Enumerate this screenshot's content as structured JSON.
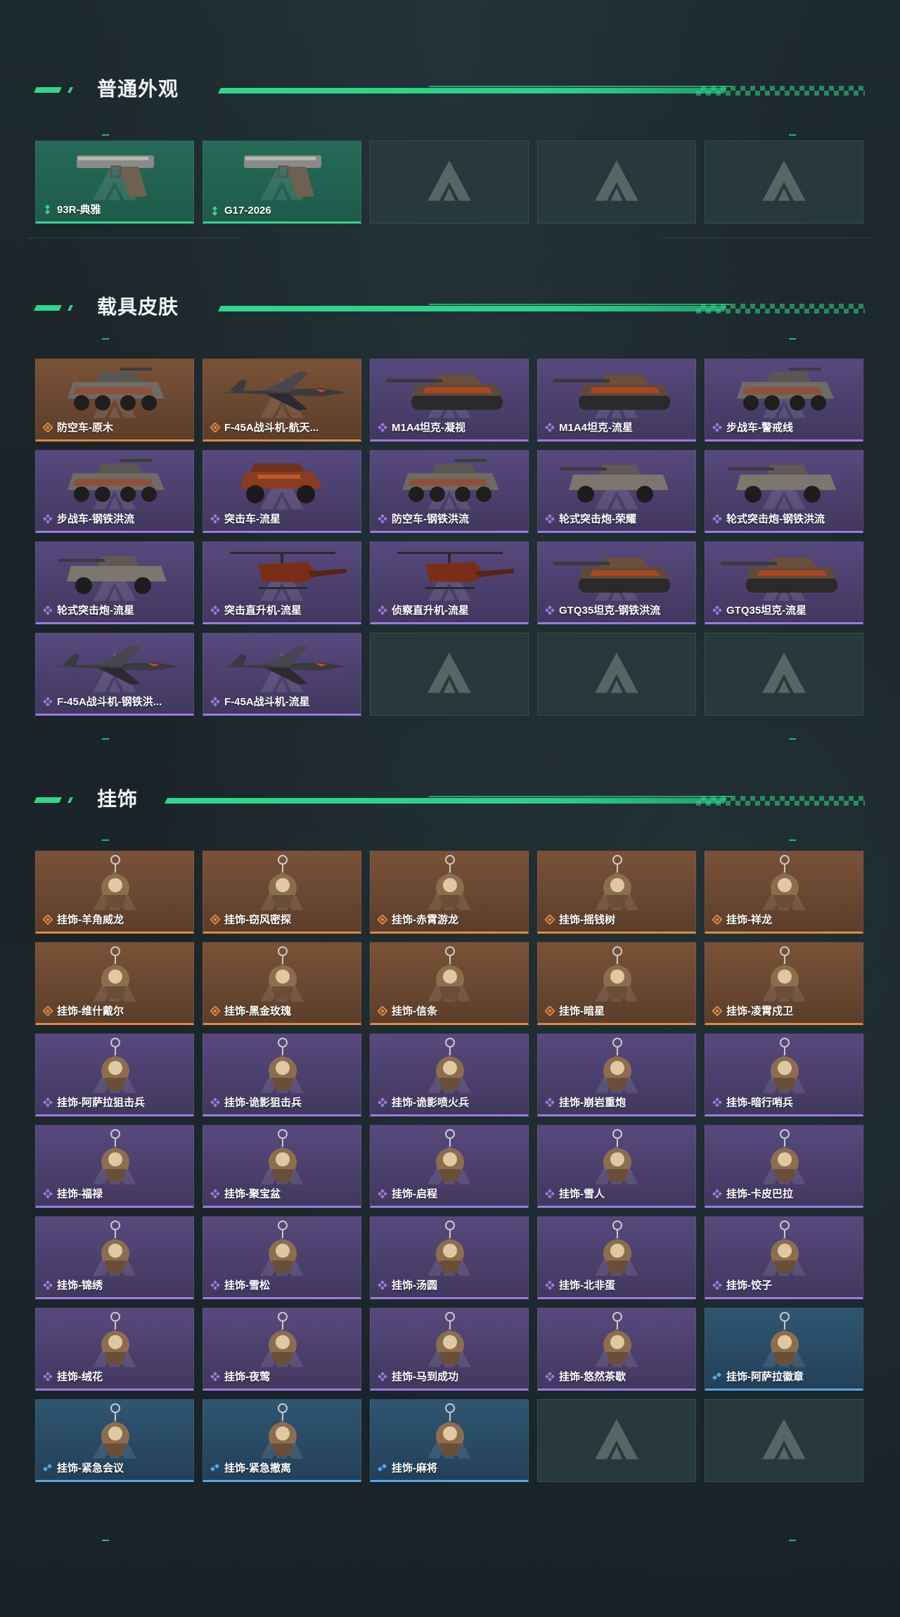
{
  "colors": {
    "accent": "#2fd88b",
    "rarity_green": "#31d690",
    "rarity_orange": "#e2883f",
    "rarity_purple": "#9c7be0",
    "rarity_blue": "#56a8e6"
  },
  "sections": {
    "normal_appearance": {
      "title": "普通外观",
      "items": [
        {
          "label": "93R-典雅",
          "rarity": "green",
          "icon": "pistol-icon"
        },
        {
          "label": "G17-2026",
          "rarity": "green",
          "icon": "pistol-icon"
        },
        {
          "label": "",
          "rarity": "empty"
        },
        {
          "label": "",
          "rarity": "empty"
        },
        {
          "label": "",
          "rarity": "empty"
        }
      ]
    },
    "vehicle_skins": {
      "title": "载具皮肤",
      "items": [
        {
          "label": "防空车-原木",
          "rarity": "orange",
          "icon": "armored-vehicle-icon"
        },
        {
          "label": "F-45A战斗机-航天...",
          "rarity": "orange",
          "icon": "fighter-jet-icon"
        },
        {
          "label": "M1A4坦克-凝视",
          "rarity": "purple",
          "icon": "tank-icon"
        },
        {
          "label": "M1A4坦克-流星",
          "rarity": "purple",
          "icon": "tank-icon"
        },
        {
          "label": "步战车-警戒线",
          "rarity": "purple",
          "icon": "armored-vehicle-icon"
        },
        {
          "label": "步战车-钢铁洪流",
          "rarity": "purple",
          "icon": "armored-vehicle-icon"
        },
        {
          "label": "突击车-流星",
          "rarity": "purple",
          "icon": "assault-vehicle-icon"
        },
        {
          "label": "防空车-钢铁洪流",
          "rarity": "purple",
          "icon": "armored-vehicle-icon"
        },
        {
          "label": "轮式突击炮-荣耀",
          "rarity": "purple",
          "icon": "wheeled-gun-icon"
        },
        {
          "label": "轮式突击炮-钢铁洪流",
          "rarity": "purple",
          "icon": "wheeled-gun-icon"
        },
        {
          "label": "轮式突击炮-流星",
          "rarity": "purple",
          "icon": "wheeled-gun-icon"
        },
        {
          "label": "突击直升机-流星",
          "rarity": "purple",
          "icon": "helicopter-icon"
        },
        {
          "label": "侦察直升机-流星",
          "rarity": "purple",
          "icon": "helicopter-icon"
        },
        {
          "label": "GTQ35坦克-钢铁洪流",
          "rarity": "purple",
          "icon": "tank-icon"
        },
        {
          "label": "GTQ35坦克-流星",
          "rarity": "purple",
          "icon": "tank-icon"
        },
        {
          "label": "F-45A战斗机-钢铁洪...",
          "rarity": "purple",
          "icon": "fighter-jet-icon"
        },
        {
          "label": "F-45A战斗机-流星",
          "rarity": "purple",
          "icon": "fighter-jet-icon"
        },
        {
          "label": "",
          "rarity": "empty"
        },
        {
          "label": "",
          "rarity": "empty"
        },
        {
          "label": "",
          "rarity": "empty"
        }
      ]
    },
    "charms": {
      "title": "挂饰",
      "items": [
        {
          "label": "挂饰-羊角威龙",
          "rarity": "orange",
          "icon": "charm-icon"
        },
        {
          "label": "挂饰-窃风密探",
          "rarity": "orange",
          "icon": "charm-icon"
        },
        {
          "label": "挂饰-赤霄游龙",
          "rarity": "orange",
          "icon": "charm-icon"
        },
        {
          "label": "挂饰-摇钱树",
          "rarity": "orange",
          "icon": "charm-icon"
        },
        {
          "label": "挂饰-祥龙",
          "rarity": "orange",
          "icon": "charm-icon"
        },
        {
          "label": "挂饰-维什戴尔",
          "rarity": "orange",
          "icon": "charm-icon"
        },
        {
          "label": "挂饰-黑金玫瑰",
          "rarity": "orange",
          "icon": "charm-icon"
        },
        {
          "label": "挂饰-信条",
          "rarity": "orange",
          "icon": "charm-icon"
        },
        {
          "label": "挂饰-暗星",
          "rarity": "orange",
          "icon": "charm-icon"
        },
        {
          "label": "挂饰-凌霄戍卫",
          "rarity": "orange",
          "icon": "charm-icon"
        },
        {
          "label": "挂饰-阿萨拉狙击兵",
          "rarity": "purple",
          "icon": "charm-icon"
        },
        {
          "label": "挂饰-诡影狙击兵",
          "rarity": "purple",
          "icon": "charm-icon"
        },
        {
          "label": "挂饰-诡影喷火兵",
          "rarity": "purple",
          "icon": "charm-icon"
        },
        {
          "label": "挂饰-崩岩重炮",
          "rarity": "purple",
          "icon": "charm-icon"
        },
        {
          "label": "挂饰-暗行哨兵",
          "rarity": "purple",
          "icon": "charm-icon"
        },
        {
          "label": "挂饰-福禄",
          "rarity": "purple",
          "icon": "charm-icon"
        },
        {
          "label": "挂饰-聚宝盆",
          "rarity": "purple",
          "icon": "charm-icon"
        },
        {
          "label": "挂饰-启程",
          "rarity": "purple",
          "icon": "charm-icon"
        },
        {
          "label": "挂饰-雪人",
          "rarity": "purple",
          "icon": "charm-icon"
        },
        {
          "label": "挂饰-卡皮巴拉",
          "rarity": "purple",
          "icon": "charm-icon"
        },
        {
          "label": "挂饰-锦绣",
          "rarity": "purple",
          "icon": "charm-icon"
        },
        {
          "label": "挂饰-雪松",
          "rarity": "purple",
          "icon": "charm-icon"
        },
        {
          "label": "挂饰-汤圆",
          "rarity": "purple",
          "icon": "charm-icon"
        },
        {
          "label": "挂饰-北非蛋",
          "rarity": "purple",
          "icon": "charm-icon"
        },
        {
          "label": "挂饰-饺子",
          "rarity": "purple",
          "icon": "charm-icon"
        },
        {
          "label": "挂饰-绒花",
          "rarity": "purple",
          "icon": "charm-icon"
        },
        {
          "label": "挂饰-夜莺",
          "rarity": "purple",
          "icon": "charm-icon"
        },
        {
          "label": "挂饰-马到成功",
          "rarity": "purple",
          "icon": "charm-icon"
        },
        {
          "label": "挂饰-悠然茶歇",
          "rarity": "purple",
          "icon": "charm-icon"
        },
        {
          "label": "挂饰-阿萨拉徽章",
          "rarity": "blue",
          "icon": "charm-icon"
        },
        {
          "label": "挂饰-紧急会议",
          "rarity": "blue",
          "icon": "charm-icon"
        },
        {
          "label": "挂饰-紧急撤离",
          "rarity": "blue",
          "icon": "charm-icon"
        },
        {
          "label": "挂饰-麻将",
          "rarity": "blue",
          "icon": "charm-icon"
        },
        {
          "label": "",
          "rarity": "empty"
        },
        {
          "label": "",
          "rarity": "empty"
        }
      ]
    }
  }
}
